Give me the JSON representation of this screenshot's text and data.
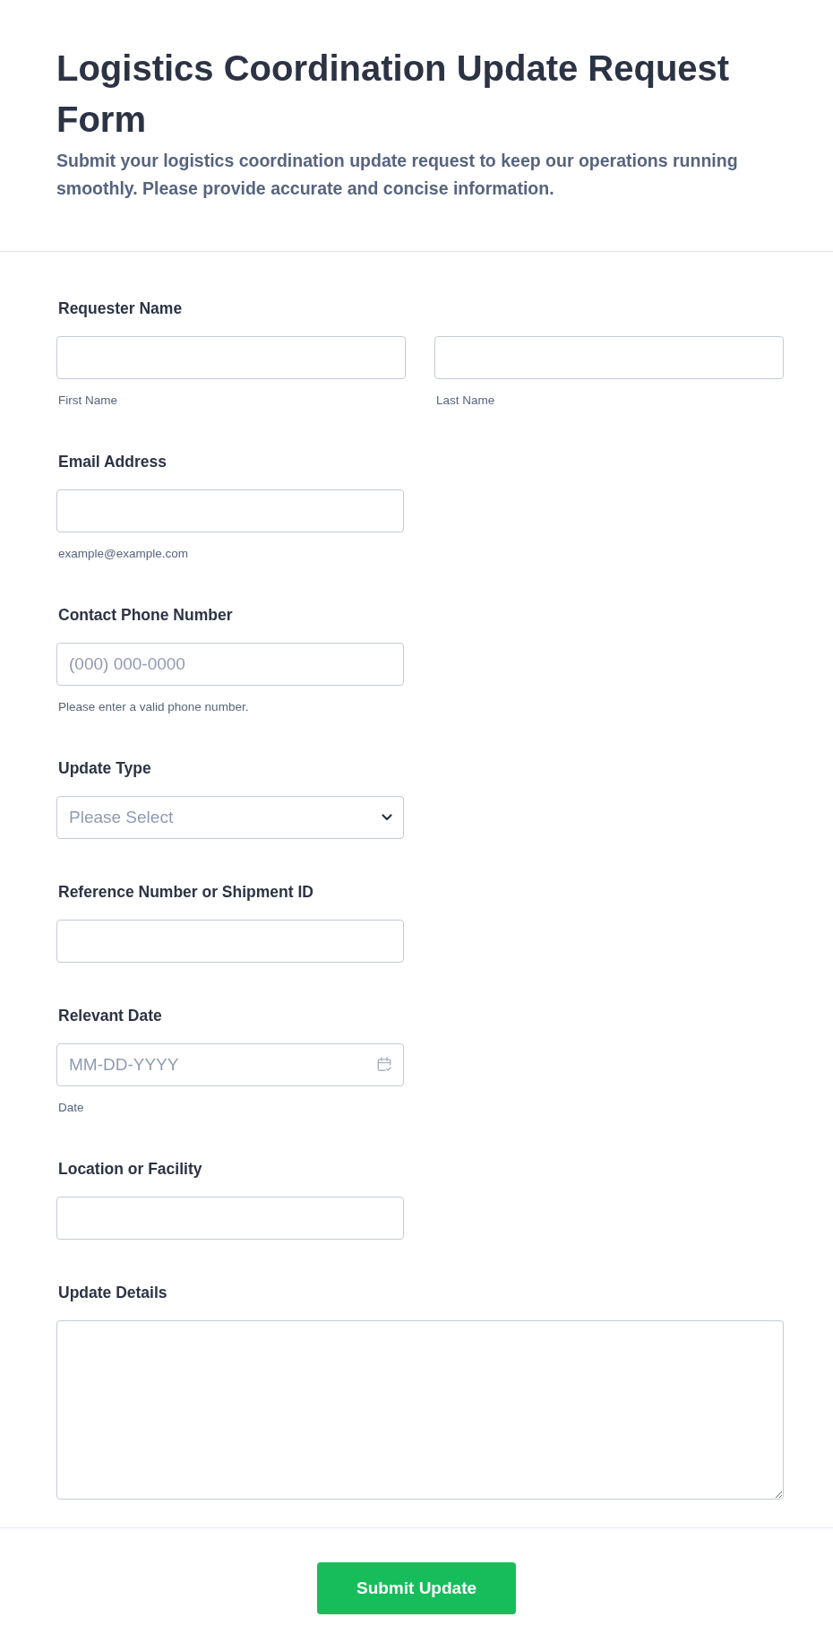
{
  "header": {
    "title": "Logistics Coordination Update Request Form",
    "description": "Submit your logistics coordination update request to keep our operations running smoothly. Please provide accurate and concise information."
  },
  "fields": [
    {
      "kind": "name",
      "label": "Requester Name",
      "parts": [
        {
          "sublabel": "First Name"
        },
        {
          "sublabel": "Last Name"
        }
      ]
    },
    {
      "kind": "text",
      "label": "Email Address",
      "sublabel": "example@example.com"
    },
    {
      "kind": "text",
      "label": "Contact Phone Number",
      "placeholder": "(000) 000-0000",
      "sublabel": "Please enter a valid phone number."
    },
    {
      "kind": "select",
      "label": "Update Type",
      "placeholder": "Please Select"
    },
    {
      "kind": "text",
      "label": "Reference Number or Shipment ID"
    },
    {
      "kind": "date",
      "label": "Relevant Date",
      "placeholder": "MM-DD-YYYY",
      "sublabel": "Date"
    },
    {
      "kind": "text",
      "label": "Location or Facility"
    },
    {
      "kind": "textarea",
      "label": "Update Details"
    }
  ],
  "submit_button": {
    "label": "Submit Update"
  }
}
